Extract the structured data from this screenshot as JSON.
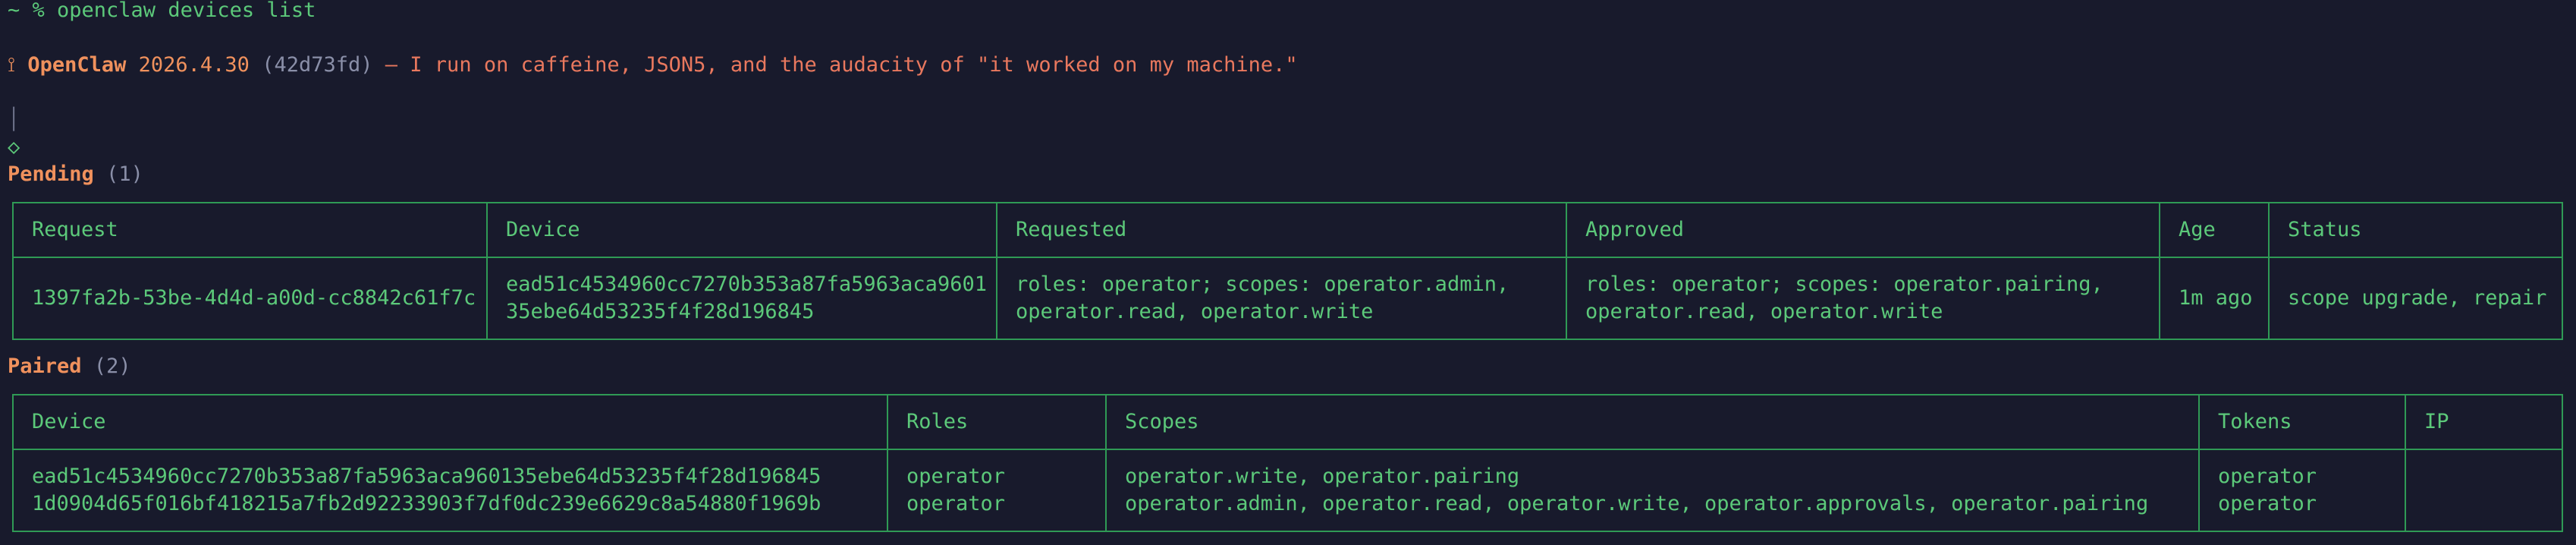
{
  "terminal": {
    "prompt": "~ % openclaw devices list",
    "banner": {
      "icon": "lobster-claw-icon",
      "app_name": "OpenClaw",
      "version": "2026.4.30",
      "commit": "(42d73fd)",
      "tagline": "— I run on caffeine, JSON5, and the audacity of \"it worked on my machine.\""
    },
    "tree_bar": "│",
    "tree_node": "◇",
    "pending": {
      "title": "Pending",
      "count": "(1)",
      "headers": [
        "Request",
        "Device",
        "Requested",
        "Approved",
        "Age",
        "Status"
      ],
      "rows": [
        {
          "request": "1397fa2b-53be-4d4d-a00d-cc8842c61f7c",
          "device": "ead51c4534960cc7270b353a87fa5963aca9601\n35ebe64d53235f4f28d196845",
          "requested": "roles: operator; scopes: operator.admin,\noperator.read, operator.write",
          "approved": "roles: operator; scopes: operator.pairing,\noperator.read, operator.write",
          "age": "1m ago",
          "status": "scope upgrade, repair"
        }
      ]
    },
    "paired": {
      "title": "Paired",
      "count": "(2)",
      "headers": [
        "Device",
        "Roles",
        "Scopes",
        "Tokens",
        "IP"
      ],
      "rows": [
        {
          "device": "ead51c4534960cc7270b353a87fa5963aca960135ebe64d53235f4f28d196845\n1d0904d65f016bf418215a7fb2d92233903f7df0dc239e6629c8a54880f1969b",
          "roles": "operator\noperator",
          "scopes": "operator.write, operator.pairing\noperator.admin, operator.read, operator.write, operator.approvals, operator.pairing",
          "tokens": "operator\noperator",
          "ip": ""
        }
      ]
    },
    "colors": {
      "background": "#181a2c",
      "green": "#5cc97a",
      "border": "#2f9a55",
      "orange": "#f0915d",
      "salmon": "#e9785e"
    }
  }
}
